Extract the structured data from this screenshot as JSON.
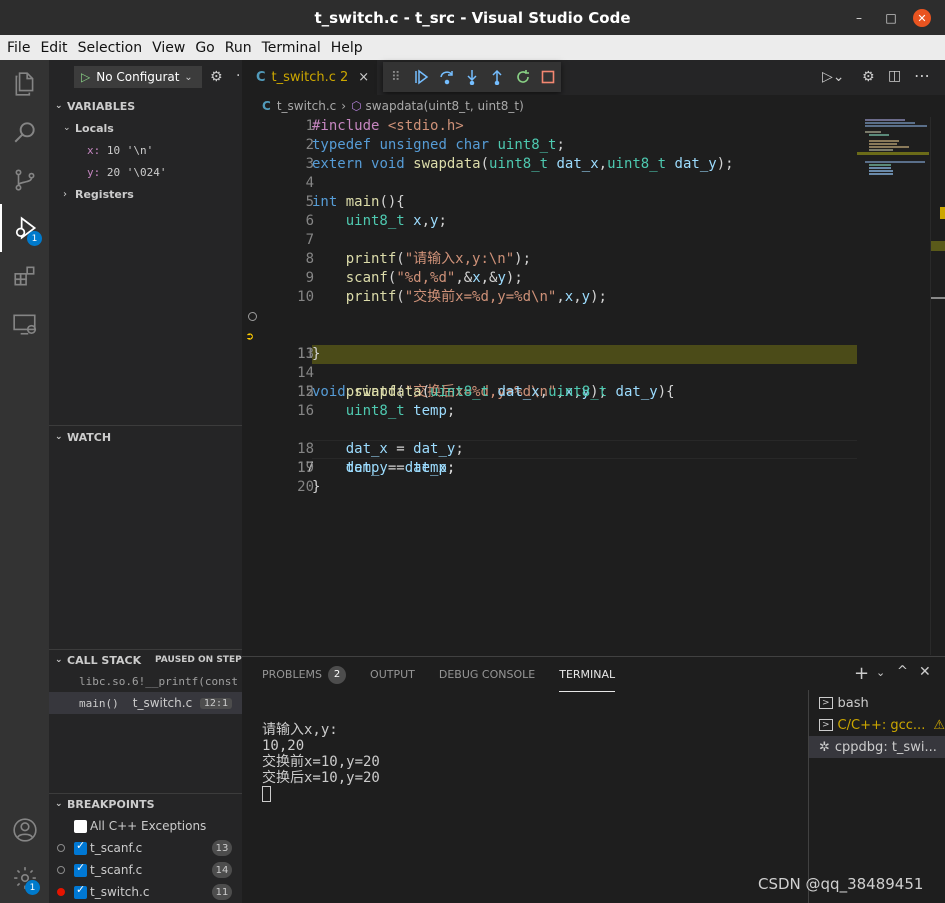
{
  "window": {
    "title": "t_switch.c - t_src - Visual Studio Code",
    "minimize": "–",
    "maximize": "□",
    "close": "✕"
  },
  "menu": [
    "File",
    "Edit",
    "Selection",
    "View",
    "Go",
    "Run",
    "Terminal",
    "Help"
  ],
  "activity_bar": {
    "items": [
      "explorer-icon",
      "search-icon",
      "source-control-icon",
      "run-debug-icon",
      "extensions-icon",
      "remote-explorer-icon"
    ],
    "run_badge": "1",
    "settings_badge": "1"
  },
  "debug": {
    "config_label": "No Configurat",
    "more": "·"
  },
  "variables": {
    "header": "VARIABLES",
    "locals_label": "Locals",
    "locals": [
      {
        "name": "x:",
        "value": "10 '\\n'"
      },
      {
        "name": "y:",
        "value": "20 '\\024'"
      }
    ],
    "registers_label": "Registers"
  },
  "watch": {
    "header": "WATCH"
  },
  "call_stack": {
    "header": "CALL STACK",
    "status": "PAUSED ON STEP",
    "frames": [
      {
        "name": "libc.so.6!__printf(const",
        "file": "",
        "line": ""
      },
      {
        "name": "main()",
        "file": "t_switch.c",
        "line": "12:1"
      }
    ]
  },
  "breakpoints": {
    "header": "BREAKPOINTS",
    "items": [
      {
        "label": "All C++ Exceptions",
        "checked": false,
        "count": ""
      },
      {
        "label": "t_scanf.c",
        "checked": true,
        "count": "13"
      },
      {
        "label": "t_scanf.c",
        "checked": true,
        "count": "14"
      },
      {
        "label": "t_switch.c",
        "checked": true,
        "count": "11"
      }
    ]
  },
  "editor": {
    "tab_icon": "C",
    "tab_label": "t_switch.c",
    "tab_problems": "2",
    "tab_close": "×",
    "breadcrumb_file": "t_switch.c",
    "breadcrumb_symbol": "swapdata(uint8_t, uint8_t)",
    "current_line": 17,
    "paused_line": 12,
    "breakpoint_line": 11,
    "lines": [
      "1",
      "2",
      "3",
      "4",
      "5",
      "6",
      "7",
      "8",
      "9",
      "10",
      "11",
      "12",
      "13",
      "14",
      "15",
      "16",
      "17",
      "18",
      "19",
      "20"
    ]
  },
  "panel": {
    "tabs": [
      "PROBLEMS",
      "OUTPUT",
      "DEBUG CONSOLE",
      "TERMINAL"
    ],
    "problems_count": "2",
    "active_tab": "TERMINAL",
    "terminal_lines": [
      "请输入x,y:",
      "10,20",
      "交换前x=10,y=20",
      "交换后x=10,y=20"
    ],
    "terminals": [
      "bash",
      "C/C++: gcc...",
      "cppdbg: t_swi..."
    ]
  },
  "watermark": "CSDN @qq_38489451",
  "colors": {
    "accent": "#007acc",
    "paused_line": "#4b4b18",
    "breakpoint": "#e51400",
    "title_close": "#e95420"
  }
}
